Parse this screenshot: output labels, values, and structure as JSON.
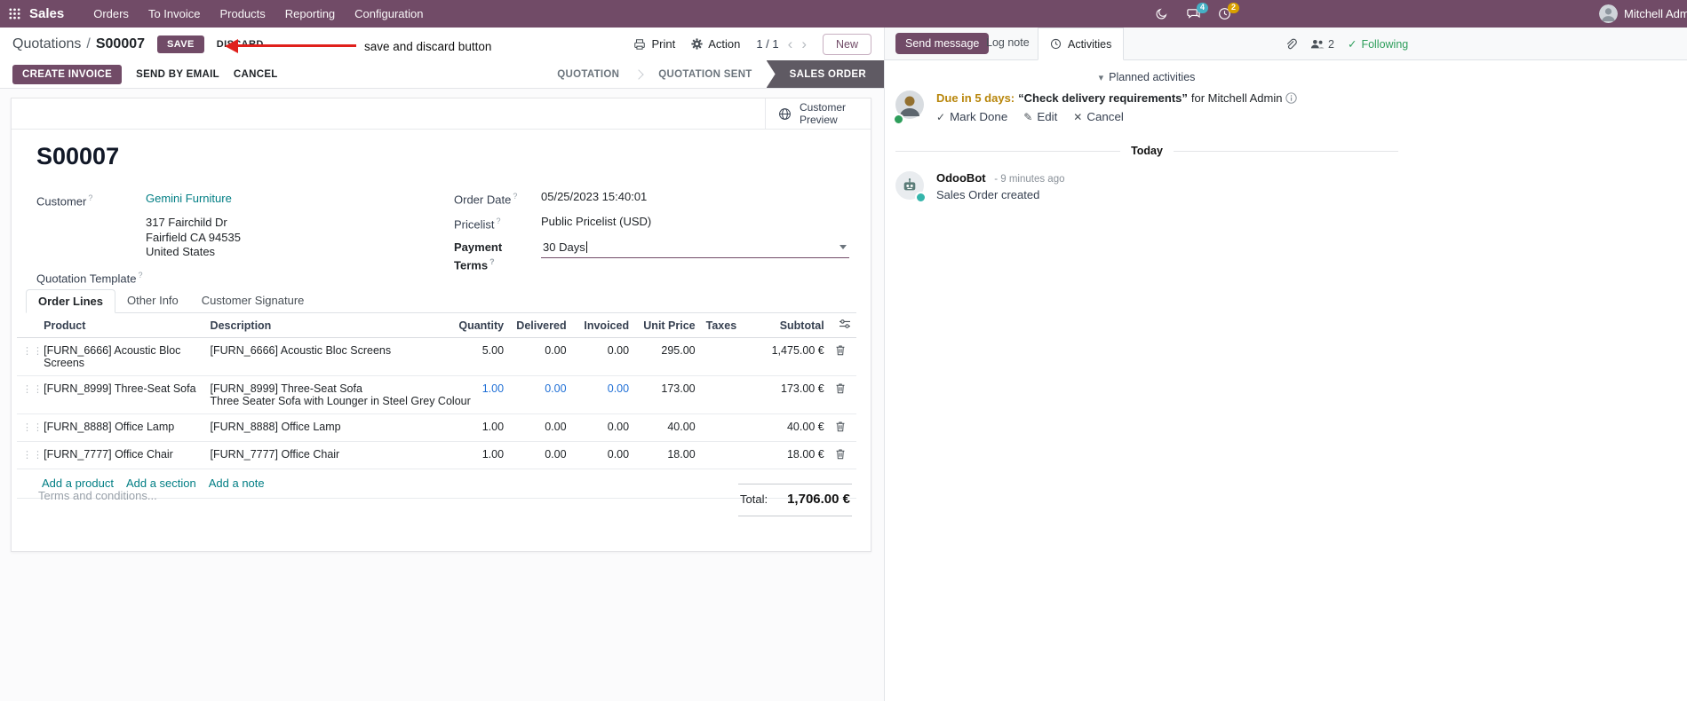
{
  "navbar": {
    "app_name": "Sales",
    "menus": [
      "Orders",
      "To Invoice",
      "Products",
      "Reporting",
      "Configuration"
    ],
    "messages_badge": "4",
    "activities_badge": "2",
    "user_name": "Mitchell Admin (save_discar"
  },
  "annotation": {
    "text": "save and discard button"
  },
  "breadcrumb": {
    "parent": "Quotations",
    "separator": "/",
    "current": "S00007",
    "save": "SAVE",
    "discard": "DISCARD"
  },
  "control_panel": {
    "print": "Print",
    "action": "Action",
    "pager": "1 / 1",
    "new": "New"
  },
  "status_buttons": {
    "create_invoice": "CREATE INVOICE",
    "send_by_email": "SEND BY EMAIL",
    "cancel": "CANCEL"
  },
  "stages": [
    {
      "label": "QUOTATION"
    },
    {
      "label": "QUOTATION SENT"
    },
    {
      "label": "SALES ORDER"
    }
  ],
  "sheet": {
    "customer_preview": "Customer Preview",
    "hint": "?",
    "title": "S00007",
    "customer_label": "Customer",
    "customer_name": "Gemini Furniture",
    "address_line1": "317 Fairchild Dr",
    "address_line2": "Fairfield CA 94535",
    "address_line3": "United States",
    "quotation_template_label": "Quotation Template",
    "order_date_label": "Order Date",
    "order_date_value": "05/25/2023 15:40:01",
    "pricelist_label": "Pricelist",
    "pricelist_value": "Public Pricelist (USD)",
    "payment_terms_label": "Payment Terms",
    "payment_terms_value": "30 Days",
    "tabs": [
      "Order Lines",
      "Other Info",
      "Customer Signature"
    ],
    "columns": [
      "Product",
      "Description",
      "Quantity",
      "Delivered",
      "Invoiced",
      "Unit Price",
      "Taxes",
      "Subtotal"
    ],
    "rows": [
      {
        "product": "[FURN_6666] Acoustic Bloc Screens",
        "description": "[FURN_6666] Acoustic Bloc Screens",
        "description2": "",
        "quantity": "5.00",
        "delivered": "0.00",
        "invoiced": "0.00",
        "unit_price": "295.00",
        "taxes": "",
        "subtotal": "1,475.00 €"
      },
      {
        "product": "[FURN_8999] Three-Seat Sofa",
        "description": "[FURN_8999] Three-Seat Sofa",
        "description2": "Three Seater Sofa with Lounger in Steel Grey Colour",
        "quantity": "1.00",
        "delivered": "0.00",
        "invoiced": "0.00",
        "unit_price": "173.00",
        "taxes": "",
        "subtotal": "173.00 €"
      },
      {
        "product": "[FURN_8888] Office Lamp",
        "description": "[FURN_8888] Office Lamp",
        "description2": "",
        "quantity": "1.00",
        "delivered": "0.00",
        "invoiced": "0.00",
        "unit_price": "40.00",
        "taxes": "",
        "subtotal": "40.00 €"
      },
      {
        "product": "[FURN_7777] Office Chair",
        "description": "[FURN_7777] Office Chair",
        "description2": "",
        "quantity": "1.00",
        "delivered": "0.00",
        "invoiced": "0.00",
        "unit_price": "18.00",
        "taxes": "",
        "subtotal": "18.00 €"
      }
    ],
    "add_links": [
      "Add a product",
      "Add a section",
      "Add a note"
    ],
    "terms_placeholder": "Terms and conditions...",
    "total_label": "Total:",
    "total_value": "1,706.00 €"
  },
  "chatter": {
    "send_message": "Send message",
    "log_note": "Log note",
    "activities_tab": "Activities",
    "followers_count": "2",
    "following": "Following",
    "planned_header": "Planned activities",
    "activity_due": "Due in 5 days:",
    "activity_summary": "“Check delivery requirements”",
    "activity_for": "for Mitchell Admin",
    "mark_done": "Mark Done",
    "edit": "Edit",
    "cancel": "Cancel",
    "today": "Today",
    "author": "OdooBot",
    "time": "- 9 minutes ago",
    "body": "Sales Order created"
  },
  "icons": {
    "prev": "‹",
    "next": "›",
    "caret_down": "▾",
    "check": "✓",
    "pencil": "✎",
    "x": "✕",
    "drag": "⋮⋮"
  },
  "colors": {
    "brand": "#714B67",
    "link": "#017e84",
    "edited_value": "#1f6fd6",
    "stage_active": "#5f5a63",
    "activity_due": "#b8860b",
    "following": "#2e9e5b",
    "annotation_red": "#e0201c"
  }
}
